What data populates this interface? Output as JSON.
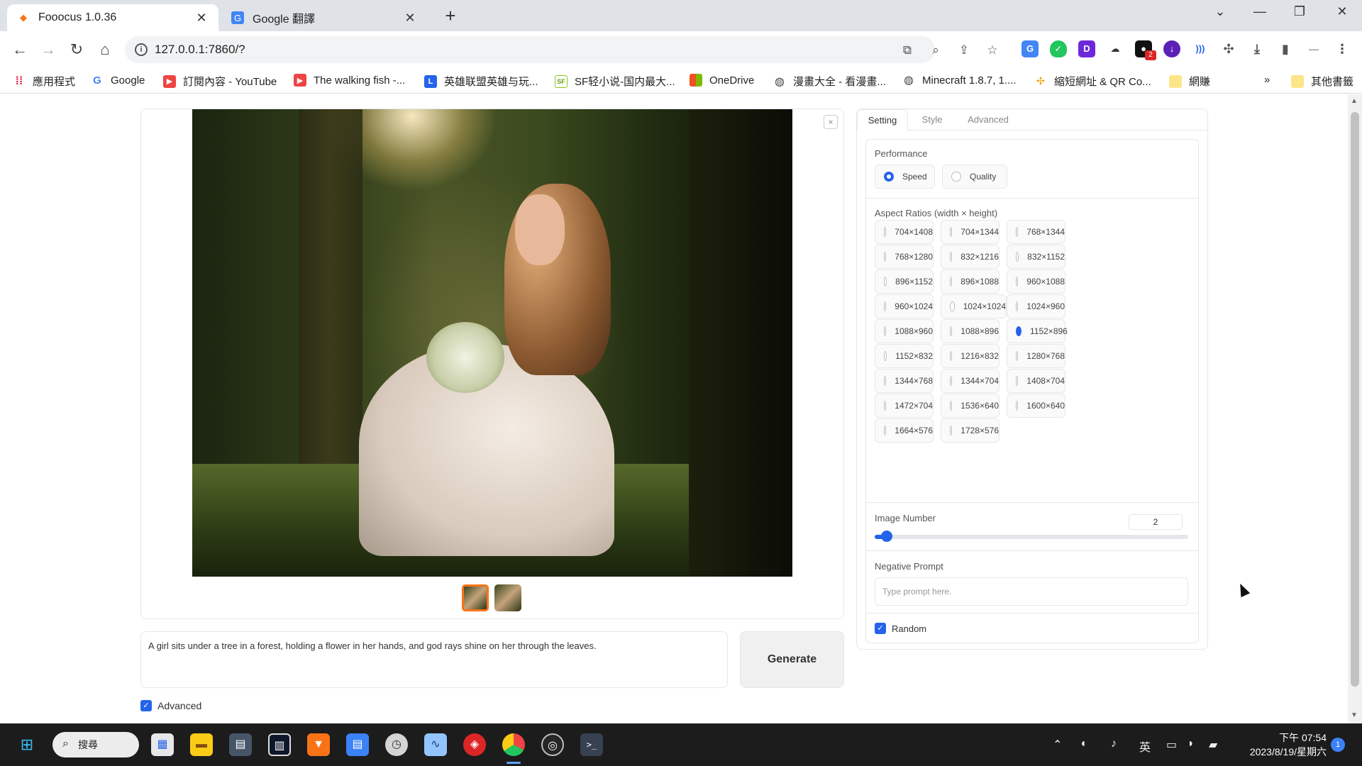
{
  "browser": {
    "tabs": [
      {
        "title": "Fooocus 1.0.36",
        "icon": "fooocus-icon"
      },
      {
        "title": "Google 翻譯",
        "icon": "google-translate-icon"
      }
    ],
    "url": "127.0.0.1:7860/?",
    "bookmarks": [
      {
        "label": "應用程式",
        "icon": "apps-grid-icon"
      },
      {
        "label": "Google",
        "icon": "google-icon"
      },
      {
        "label": "訂閱內容 - YouTube",
        "icon": "youtube-icon"
      },
      {
        "label": "The walking fish -...",
        "icon": "youtube-icon"
      },
      {
        "label": "英雄联盟英雄与玩...",
        "icon": "league-icon"
      },
      {
        "label": "SF轻小说-国内最大...",
        "icon": "sf-icon"
      },
      {
        "label": "OneDrive",
        "icon": "microsoft-icon"
      },
      {
        "label": "漫畫大全 - 看漫畫...",
        "icon": "globe-icon"
      },
      {
        "label": "Minecraft 1.8.7, 1....",
        "icon": "globe-icon"
      },
      {
        "label": "縮短網址 & QR Co...",
        "icon": "dots-icon"
      },
      {
        "label": "網賺",
        "icon": "folder-icon"
      },
      {
        "label": "其他書籤",
        "icon": "folder-icon"
      }
    ],
    "overflow_label": "»",
    "extension_badge": "2"
  },
  "app": {
    "prompt": "A girl sits under a tree in a forest, holding a flower in her hands, and god rays shine on her through the leaves.",
    "generate_label": "Generate",
    "advanced_label": "Advanced",
    "advanced_checked": true,
    "gallery_close": "×"
  },
  "panel": {
    "tabs": [
      "Setting",
      "Style",
      "Advanced"
    ],
    "active_tab": "Setting",
    "performance_label": "Performance",
    "performance_options": [
      "Speed",
      "Quality"
    ],
    "performance_selected": "Speed",
    "aspect_label": "Aspect Ratios (width × height)",
    "aspect_options": [
      "704×1408",
      "704×1344",
      "768×1344",
      "768×1280",
      "832×1216",
      "832×1152",
      "896×1152",
      "896×1088",
      "960×1088",
      "960×1024",
      "1024×1024",
      "1024×960",
      "1088×960",
      "1088×896",
      "1152×896",
      "1152×832",
      "1216×832",
      "1280×768",
      "1344×768",
      "1344×704",
      "1408×704",
      "1472×704",
      "1536×640",
      "1600×640",
      "1664×576",
      "1728×576"
    ],
    "aspect_selected": "1152×896",
    "image_number_label": "Image Number",
    "image_number": "2",
    "image_number_fraction": 0.03,
    "negative_label": "Negative Prompt",
    "negative_placeholder": "Type prompt here.",
    "random_label": "Random",
    "random_checked": true
  },
  "taskbar": {
    "search_label": "搜尋",
    "ime_label": "英",
    "time": "下午 07:54",
    "date": "2023/8/19/星期六",
    "notifications": "1"
  },
  "colors": {
    "accent": "#2563eb",
    "thumb_selected": "#f97316"
  }
}
